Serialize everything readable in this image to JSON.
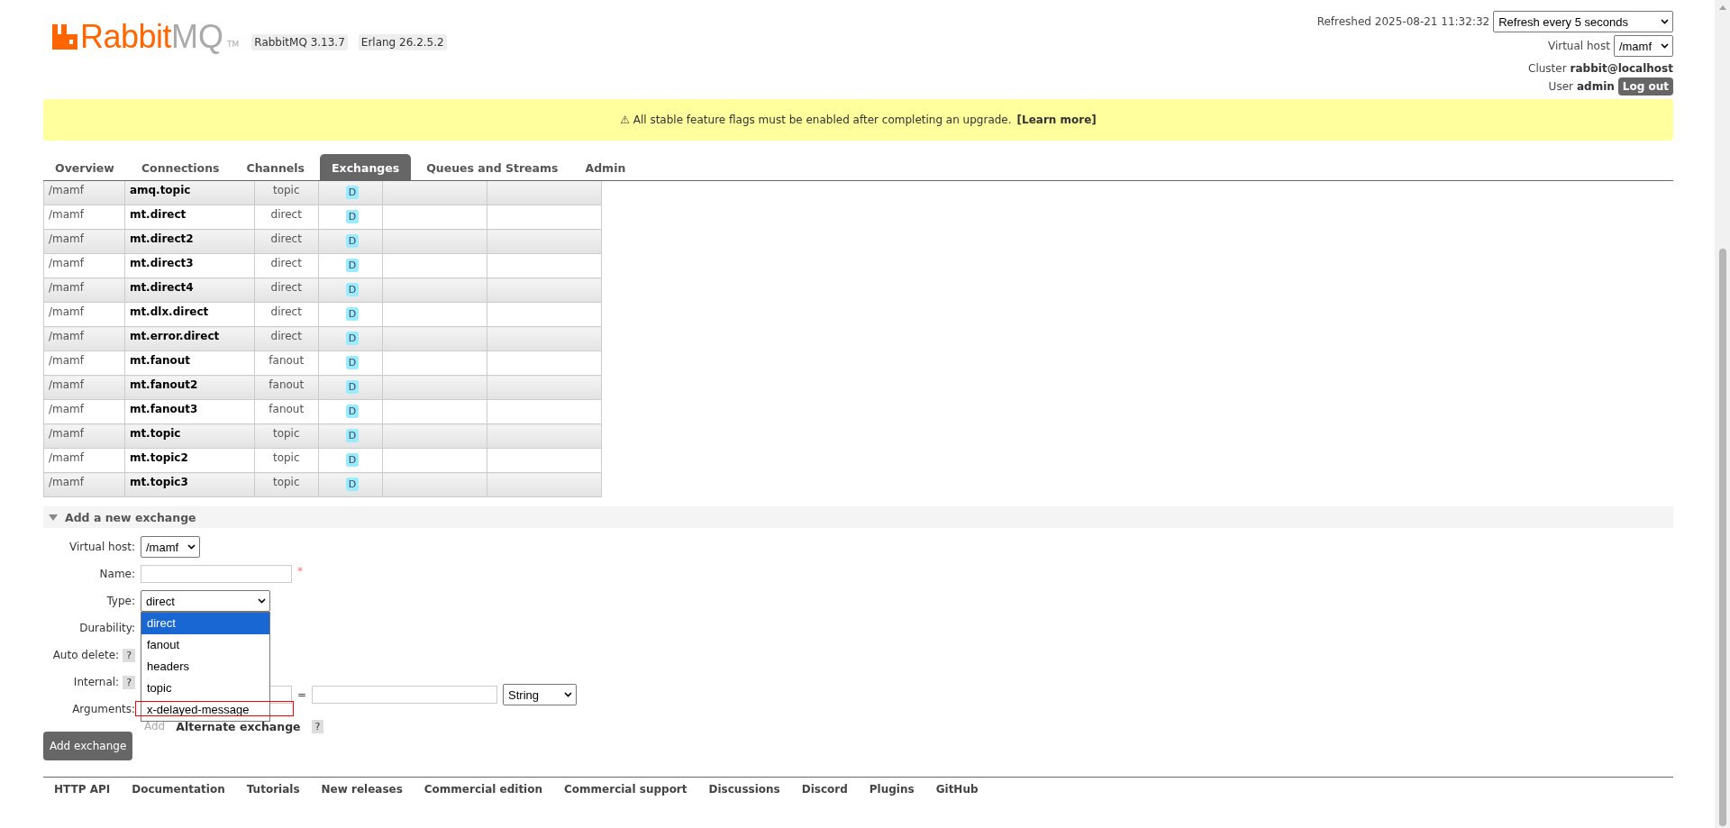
{
  "header": {
    "logo": {
      "primary": "Rabbit",
      "secondary": "MQ",
      "trademark": "TM"
    },
    "versions": [
      "RabbitMQ 3.13.7",
      "Erlang 26.2.5.2"
    ],
    "refreshed": "Refreshed 2025-08-21 11:32:32",
    "refresh_select": "Refresh every 5 seconds",
    "vhost_label": "Virtual host",
    "vhost_value": "/mamf",
    "cluster_label": "Cluster",
    "cluster_value": "rabbit@localhost",
    "user_label": "User",
    "user_value": "admin",
    "logout": "Log out"
  },
  "banner": {
    "icon": "⚠",
    "text": "All stable feature flags must be enabled after completing an upgrade.",
    "link": "[Learn more]"
  },
  "tabs": [
    {
      "label": "Overview",
      "selected": false
    },
    {
      "label": "Connections",
      "selected": false
    },
    {
      "label": "Channels",
      "selected": false
    },
    {
      "label": "Exchanges",
      "selected": true
    },
    {
      "label": "Queues and Streams",
      "selected": false
    },
    {
      "label": "Admin",
      "selected": false
    }
  ],
  "table": {
    "rows": [
      {
        "virtual_host": "/mamf",
        "name": "amq.topic",
        "type": "topic",
        "feature": "D"
      },
      {
        "virtual_host": "/mamf",
        "name": "mt.direct",
        "type": "direct",
        "feature": "D"
      },
      {
        "virtual_host": "/mamf",
        "name": "mt.direct2",
        "type": "direct",
        "feature": "D"
      },
      {
        "virtual_host": "/mamf",
        "name": "mt.direct3",
        "type": "direct",
        "feature": "D"
      },
      {
        "virtual_host": "/mamf",
        "name": "mt.direct4",
        "type": "direct",
        "feature": "D"
      },
      {
        "virtual_host": "/mamf",
        "name": "mt.dlx.direct",
        "type": "direct",
        "feature": "D"
      },
      {
        "virtual_host": "/mamf",
        "name": "mt.error.direct",
        "type": "direct",
        "feature": "D"
      },
      {
        "virtual_host": "/mamf",
        "name": "mt.fanout",
        "type": "fanout",
        "feature": "D"
      },
      {
        "virtual_host": "/mamf",
        "name": "mt.fanout2",
        "type": "fanout",
        "feature": "D"
      },
      {
        "virtual_host": "/mamf",
        "name": "mt.fanout3",
        "type": "fanout",
        "feature": "D"
      },
      {
        "virtual_host": "/mamf",
        "name": "mt.topic",
        "type": "topic",
        "feature": "D"
      },
      {
        "virtual_host": "/mamf",
        "name": "mt.topic2",
        "type": "topic",
        "feature": "D"
      },
      {
        "virtual_host": "/mamf",
        "name": "mt.topic3",
        "type": "topic",
        "feature": "D"
      }
    ]
  },
  "form": {
    "title": "Add a new exchange",
    "expanded": true,
    "fields": [
      {
        "kind": "select",
        "label": "Virtual host:",
        "value": "/mamf"
      },
      {
        "kind": "text",
        "label": "Name:",
        "required_mark": "*"
      },
      {
        "kind": "select",
        "label": "Type:",
        "value": "direct",
        "open": true
      },
      {
        "kind": "hidden",
        "label": "Durability:"
      },
      {
        "kind": "help",
        "label": "Auto delete:",
        "help": "?"
      },
      {
        "kind": "help",
        "label": "Internal:",
        "help": "?"
      },
      {
        "kind": "arguments",
        "label": "Arguments:",
        "separator": "=",
        "value_type": "String",
        "add": "Add",
        "shortcut": "Alternate exchange",
        "help": "?"
      }
    ],
    "type_options": [
      {
        "label": "direct",
        "selected": true,
        "highlighted": false
      },
      {
        "label": "fanout",
        "selected": false,
        "highlighted": false
      },
      {
        "label": "headers",
        "selected": false,
        "highlighted": false
      },
      {
        "label": "topic",
        "selected": false,
        "highlighted": false
      },
      {
        "label": "x-delayed-message",
        "selected": false,
        "highlighted": true
      }
    ],
    "submit": "Add exchange"
  },
  "footer": {
    "links": [
      "HTTP API",
      "Documentation",
      "Tutorials",
      "New releases",
      "Commercial edition",
      "Commercial support",
      "Discussions",
      "Discord",
      "Plugins",
      "GitHub"
    ]
  }
}
